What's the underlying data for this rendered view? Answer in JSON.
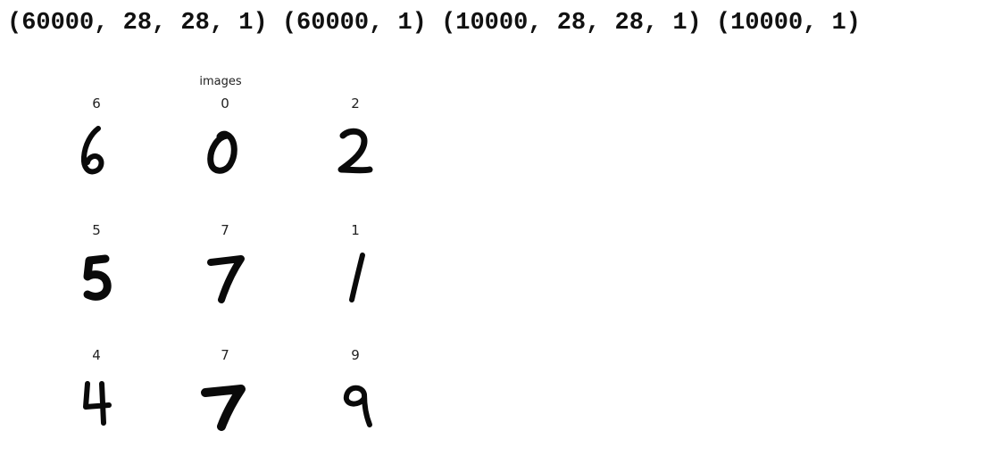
{
  "output": {
    "shapes_text": "(60000, 28, 28, 1) (60000, 1) (10000, 28, 28, 1) (10000, 1)"
  },
  "figure": {
    "title": "images",
    "grid": [
      {
        "label": "6",
        "digit": "six-digit-image"
      },
      {
        "label": "0",
        "digit": "zero-digit-image"
      },
      {
        "label": "2",
        "digit": "two-digit-image"
      },
      {
        "label": "5",
        "digit": "five-digit-image"
      },
      {
        "label": "7",
        "digit": "seven-digit-image"
      },
      {
        "label": "1",
        "digit": "one-digit-image"
      },
      {
        "label": "4",
        "digit": "four-digit-image"
      },
      {
        "label": "7",
        "digit": "seven-digit-image"
      },
      {
        "label": "9",
        "digit": "nine-digit-image"
      }
    ]
  }
}
